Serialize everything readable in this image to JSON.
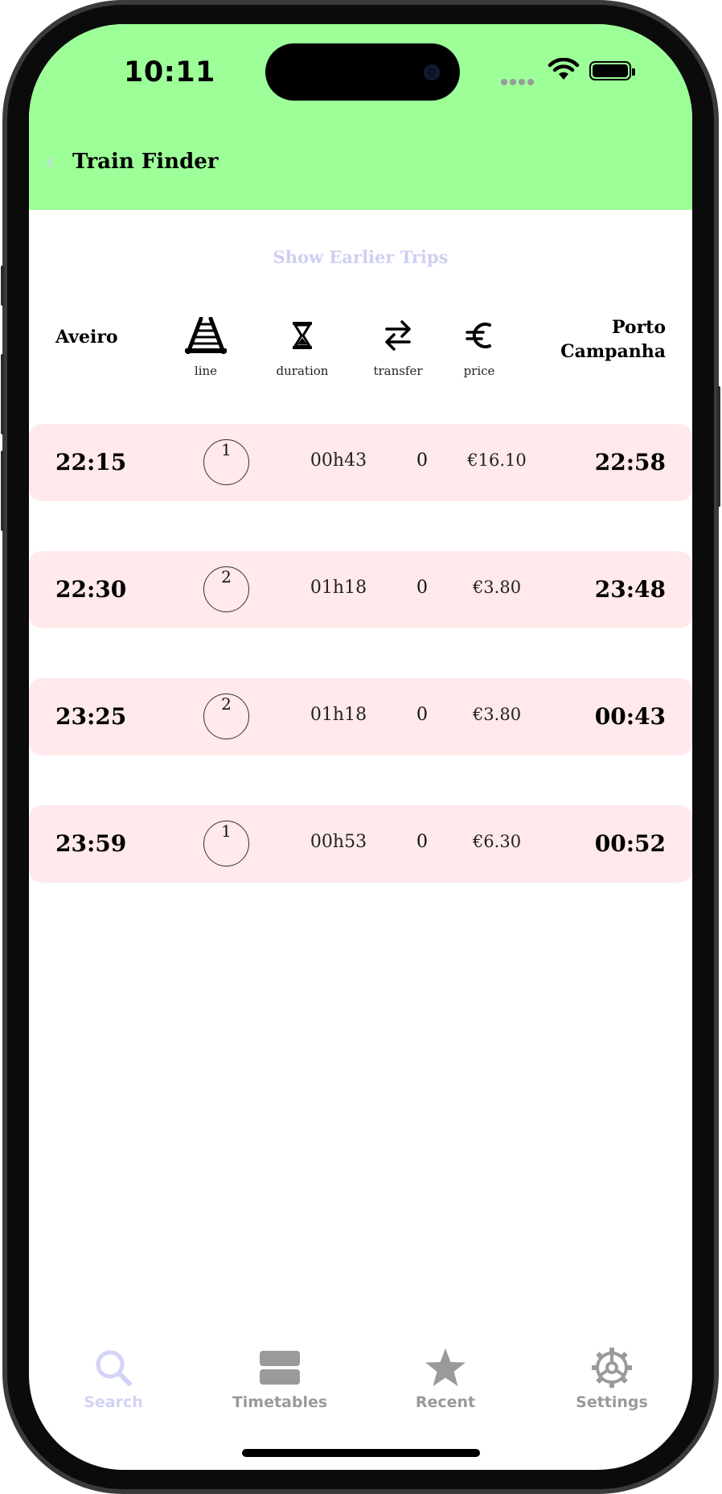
{
  "status_bar": {
    "time": "10:11"
  },
  "nav": {
    "title": "Train Finder"
  },
  "show_earlier_label": "Show Earlier Trips",
  "route": {
    "origin": "Aveiro",
    "destination_line1": "Porto",
    "destination_line2": "Campanha"
  },
  "columns": {
    "line": {
      "label": "line",
      "icon": "railway-track-icon"
    },
    "duration": {
      "label": "duration",
      "icon": "hourglass-icon"
    },
    "transfer": {
      "label": "transfer",
      "icon": "transfer-arrows-icon"
    },
    "price": {
      "label": "price",
      "icon": "euro-icon"
    }
  },
  "trips": [
    {
      "departure": "22:15",
      "line": "1",
      "duration": "00h43",
      "transfers": "0",
      "price": "€16.10",
      "arrival": "22:58"
    },
    {
      "departure": "22:30",
      "line": "2",
      "duration": "01h18",
      "transfers": "0",
      "price": "€3.80",
      "arrival": "23:48"
    },
    {
      "departure": "23:25",
      "line": "2",
      "duration": "01h18",
      "transfers": "0",
      "price": "€3.80",
      "arrival": "00:43"
    },
    {
      "departure": "23:59",
      "line": "1",
      "duration": "00h53",
      "transfers": "0",
      "price": "€6.30",
      "arrival": "00:52"
    }
  ],
  "tabs": [
    {
      "label": "Search",
      "icon": "search-icon",
      "active": true
    },
    {
      "label": "Timetables",
      "icon": "timetables-icon",
      "active": false
    },
    {
      "label": "Recent",
      "icon": "star-icon",
      "active": false
    },
    {
      "label": "Settings",
      "icon": "gear-icon",
      "active": false
    }
  ],
  "colors": {
    "header_bg": "#9cff98",
    "row_bg": "#ffe9ea",
    "accent_inactive": "#d3d3f5",
    "tab_inactive": "#9a9a9a"
  }
}
